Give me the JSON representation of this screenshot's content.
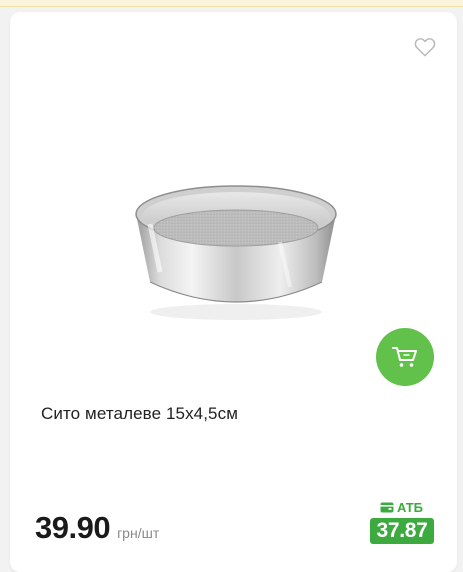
{
  "product": {
    "title": "Сито металеве 15х4,5см",
    "price": "39.90",
    "unit": "грн/шт",
    "loyalty_label": "АТБ",
    "loyalty_price": "37.87"
  },
  "icons": {
    "favorite": "heart-icon",
    "cart": "cart-icon",
    "loyalty": "wallet-icon"
  },
  "colors": {
    "accent": "#62c14a",
    "loyalty": "#3daa3f"
  }
}
